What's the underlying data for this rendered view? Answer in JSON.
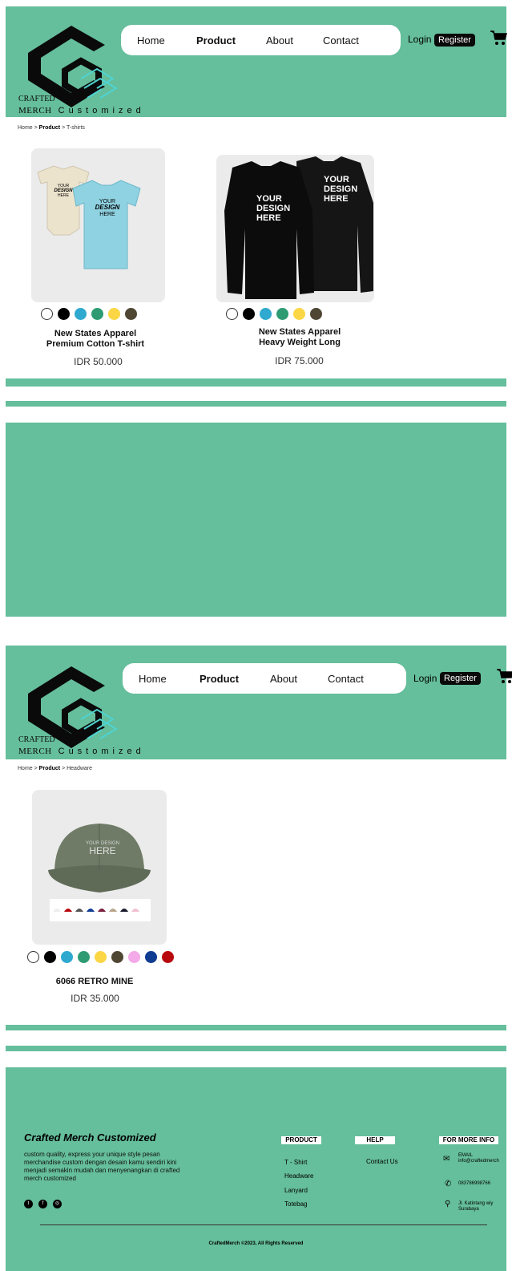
{
  "brand": {
    "logo_line1": "CRAFTED",
    "logo_line2": "MERCH",
    "logo_line3": "Customized"
  },
  "nav": {
    "items": [
      "Home",
      "Product",
      "About",
      "Contact"
    ],
    "active": "Product",
    "login_label": "Login",
    "register_label": "Register"
  },
  "section1": {
    "breadcrumb": [
      "Home",
      "Product",
      "T-shirts"
    ],
    "products": [
      {
        "image_text": [
          "YOUR",
          "DESIGN",
          "HERE"
        ],
        "name_line1": "New States Apparel",
        "name_line2": "Premium Cotton T-shirt",
        "price": "IDR 50.000",
        "swatches": [
          "#ffffff",
          "#000000",
          "#2fa9cf",
          "#2e9b73",
          "#fbd645",
          "#4f4634"
        ]
      },
      {
        "image_text": [
          "YOUR",
          "DESIGN",
          "HERE"
        ],
        "name_line1": "New States Apparel",
        "name_line2": "Heavy Weight Long",
        "price": "IDR 75.000",
        "swatches": [
          "#ffffff",
          "#000000",
          "#2fa9cf",
          "#2e9b73",
          "#fbd645",
          "#4f4634"
        ]
      }
    ]
  },
  "section2": {
    "breadcrumb": [
      "Home",
      "Product",
      "Headware"
    ],
    "products": [
      {
        "image_text": [
          "YOUR DESIGN",
          "HERE"
        ],
        "name": "6066 RETRO MINE",
        "price": "IDR 35.000",
        "swatches": [
          "#ffffff",
          "#000000",
          "#2fa9cf",
          "#2e9b73",
          "#fbd645",
          "#4f4634",
          "#f4a9e8",
          "#0f3b91",
          "#b8090e"
        ]
      }
    ]
  },
  "footer": {
    "brand": "Crafted Merch Customized",
    "description": "custom quality, express your unique style pesan merchandise custom dengan desain kamu sendiri kini menjadi semakin mudah dan menyenangkan di crafted merch customized",
    "product_heading": "PRODUCT",
    "product_links": [
      "T - Shirt",
      "Headware",
      "Lanyard",
      "Totebag"
    ],
    "help_heading": "HELP",
    "help_links": [
      "Contact Us"
    ],
    "info_heading": "FOR MORE INFO",
    "email_label": "EMAIL",
    "email_value": "info@craftedmerch",
    "phone": "083786998766",
    "address_line1": "Jl. Katintang wiy",
    "address_line2": "Surabaya",
    "copyright": "CraftedMerch  ©2023, All Rights Reserved"
  },
  "colors": {
    "accent_green": "#65be9c",
    "dark": "#0a0a0a",
    "logo_teal": "#4fd3d1"
  }
}
